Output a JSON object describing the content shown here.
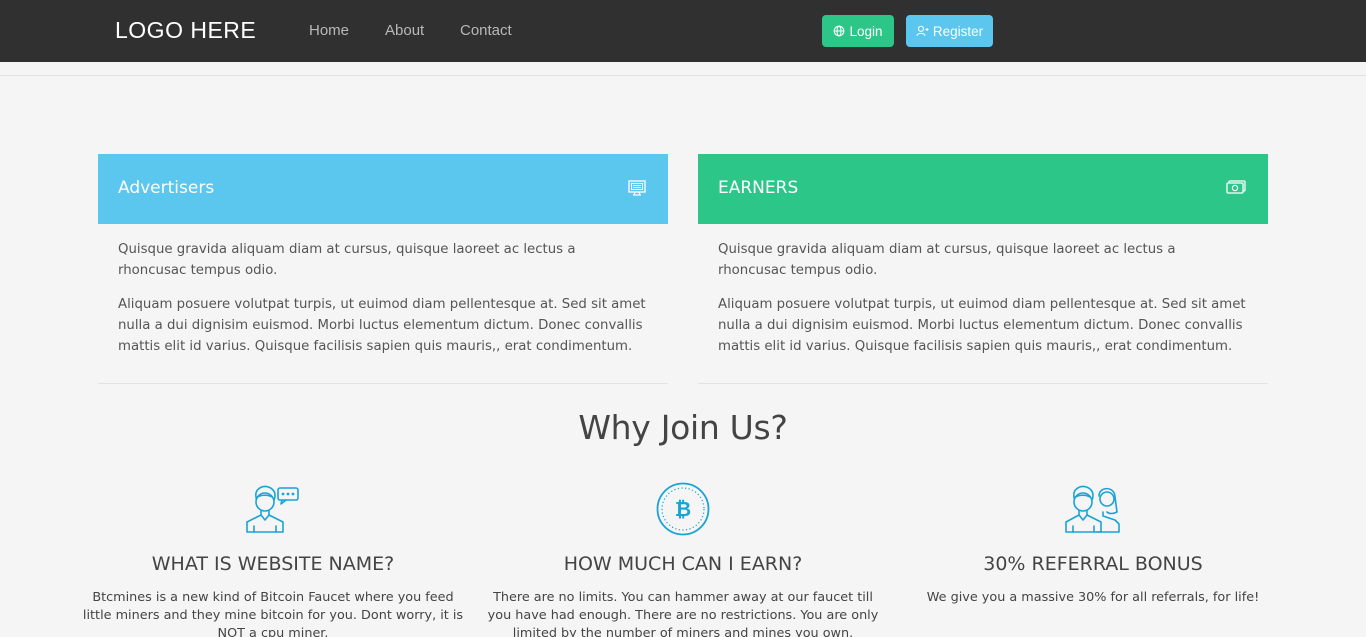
{
  "nav": {
    "logo": "LOGO HERE",
    "links": [
      "Home",
      "About",
      "Contact"
    ],
    "login_label": "Login",
    "register_label": "Register"
  },
  "cards": [
    {
      "title": "Advertisers",
      "icon": "monitor-icon",
      "color": "#5bc6ee",
      "paragraphs": [
        "Quisque gravida aliquam diam at cursus, quisque laoreet ac lectus a rhoncusac tempus odio.",
        "Aliquam posuere volutpat turpis, ut euimod diam pellentesque at. Sed sit amet nulla a dui dignisim euismod. Morbi luctus elementum dictum. Donec convallis mattis elit id varius. Quisque facilisis sapien quis mauris,, erat condimentum."
      ]
    },
    {
      "title": "EARNERS",
      "icon": "money-icon",
      "color": "#2cc689",
      "paragraphs": [
        "Quisque gravida aliquam diam at cursus, quisque laoreet ac lectus a rhoncusac tempus odio.",
        "Aliquam posuere volutpat turpis, ut euimod diam pellentesque at. Sed sit amet nulla a dui dignisim euismod. Morbi luctus elementum dictum. Donec convallis mattis elit id varius. Quisque facilisis sapien quis mauris,, erat condimentum."
      ]
    }
  ],
  "why": {
    "title": "Why Join Us?",
    "features": [
      {
        "icon": "user-chat-icon",
        "title": "WHAT IS WEBSITE NAME?",
        "text": "Btcmines is a new kind of Bitcoin Faucet where you feed little miners and they mine bitcoin for you. Dont worry, it is NOT a cpu miner."
      },
      {
        "icon": "bitcoin-icon",
        "title": "HOW MUCH CAN I EARN?",
        "text": "There are no limits. You can hammer away at our faucet till you have had enough. There are no restrictions. You are only limited by the number of miners and mines you own."
      },
      {
        "icon": "users-icon",
        "title": "30% REFERRAL BONUS",
        "text": "We give you a massive 30% for all referrals, for life!"
      }
    ]
  },
  "colors": {
    "navbar": "#303030",
    "accent_blue": "#5bc6ee",
    "accent_green": "#2cc689",
    "icon_blue": "#1aa3d6"
  }
}
